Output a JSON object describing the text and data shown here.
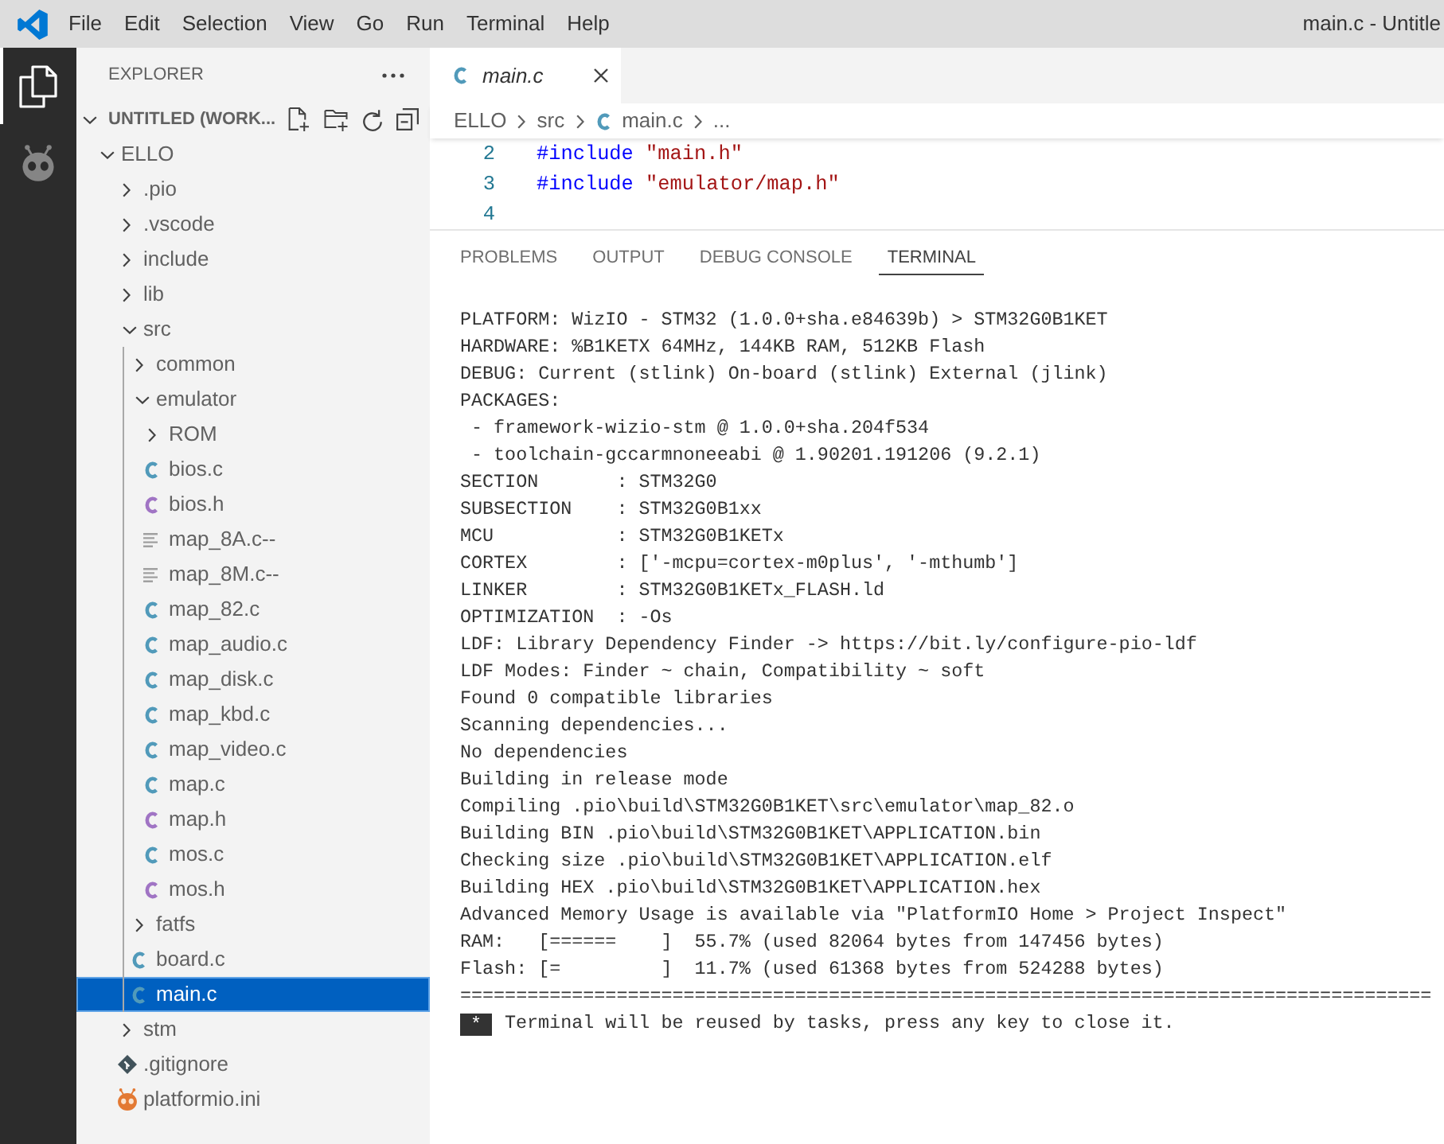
{
  "title_bar": {
    "menus": [
      "File",
      "Edit",
      "Selection",
      "View",
      "Go",
      "Run",
      "Terminal",
      "Help"
    ],
    "title": "main.c - Untitle"
  },
  "activity_bar": [
    {
      "kind": "explorer",
      "selected": true
    },
    {
      "kind": "platformio",
      "selected": false
    }
  ],
  "explorer": {
    "title": "EXPLORER",
    "workspace": {
      "label": "UNTITLED (WORK...",
      "expanded": true
    },
    "tree": [
      {
        "label": "ELLO",
        "kind": "folder",
        "expanded": true,
        "selected": false,
        "children": [
          {
            "label": ".pio",
            "kind": "folder",
            "expanded": false,
            "selected": false
          },
          {
            "label": ".vscode",
            "kind": "folder",
            "expanded": false,
            "selected": false
          },
          {
            "label": "include",
            "kind": "folder",
            "expanded": false,
            "selected": false
          },
          {
            "label": "lib",
            "kind": "folder",
            "expanded": false,
            "selected": false
          },
          {
            "label": "src",
            "kind": "folder",
            "expanded": true,
            "selected": false,
            "children": [
              {
                "label": "common",
                "kind": "folder",
                "expanded": false,
                "selected": false
              },
              {
                "label": "emulator",
                "kind": "folder",
                "expanded": true,
                "selected": false,
                "children": [
                  {
                    "label": "ROM",
                    "kind": "folder",
                    "expanded": false,
                    "selected": false
                  },
                  {
                    "label": "bios.c",
                    "kind": "c-source",
                    "selected": false
                  },
                  {
                    "label": "bios.h",
                    "kind": "c-header",
                    "selected": false
                  },
                  {
                    "label": "map_8A.c--",
                    "kind": "text",
                    "selected": false
                  },
                  {
                    "label": "map_8M.c--",
                    "kind": "text",
                    "selected": false
                  },
                  {
                    "label": "map_82.c",
                    "kind": "c-source",
                    "selected": false
                  },
                  {
                    "label": "map_audio.c",
                    "kind": "c-source",
                    "selected": false
                  },
                  {
                    "label": "map_disk.c",
                    "kind": "c-source",
                    "selected": false
                  },
                  {
                    "label": "map_kbd.c",
                    "kind": "c-source",
                    "selected": false
                  },
                  {
                    "label": "map_video.c",
                    "kind": "c-source",
                    "selected": false
                  },
                  {
                    "label": "map.c",
                    "kind": "c-source",
                    "selected": false
                  },
                  {
                    "label": "map.h",
                    "kind": "c-header",
                    "selected": false
                  },
                  {
                    "label": "mos.c",
                    "kind": "c-source",
                    "selected": false
                  },
                  {
                    "label": "mos.h",
                    "kind": "c-header",
                    "selected": false
                  }
                ]
              },
              {
                "label": "fatfs",
                "kind": "folder",
                "expanded": false,
                "selected": false
              },
              {
                "label": "board.c",
                "kind": "c-source",
                "selected": false
              },
              {
                "label": "main.c",
                "kind": "c-source",
                "selected": true
              }
            ]
          },
          {
            "label": "stm",
            "kind": "folder",
            "expanded": false,
            "selected": false
          },
          {
            "label": ".gitignore",
            "kind": "git",
            "selected": false
          },
          {
            "label": "platformio.ini",
            "kind": "platformio",
            "selected": false
          }
        ]
      }
    ]
  },
  "editor": {
    "tabs": [
      {
        "label": "main.c",
        "kind": "c-source",
        "selected": true,
        "preview": true
      }
    ],
    "breadcrumbs": [
      {
        "label": "ELLO",
        "kind": "folder"
      },
      {
        "label": "src",
        "kind": "folder"
      },
      {
        "label": "main.c",
        "kind": "c-source"
      },
      {
        "label": "...",
        "kind": "more"
      }
    ],
    "code_lines": [
      {
        "number": "2",
        "directive": "#include",
        "argument": "\"main.h\""
      },
      {
        "number": "3",
        "directive": "#include",
        "argument": "\"emulator/map.h\""
      },
      {
        "number": "4"
      }
    ]
  },
  "panel": {
    "tabs": [
      {
        "label": "PROBLEMS",
        "selected": false
      },
      {
        "label": "OUTPUT",
        "selected": false
      },
      {
        "label": "DEBUG CONSOLE",
        "selected": false
      },
      {
        "label": "TERMINAL",
        "selected": true
      }
    ],
    "terminal": {
      "lines": [
        "PLATFORM: WizIO - STM32 (1.0.0+sha.e84639b) > STM32G0B1KET",
        "HARDWARE: %B1KETX 64MHz, 144KB RAM, 512KB Flash",
        "DEBUG: Current (stlink) On-board (stlink) External (jlink)",
        "PACKAGES:",
        " - framework-wizio-stm @ 1.0.0+sha.204f534",
        " - toolchain-gccarmnoneeabi @ 1.90201.191206 (9.2.1)",
        "SECTION       : STM32G0",
        "SUBSECTION    : STM32G0B1xx",
        "MCU           : STM32G0B1KETx",
        "CORTEX        : ['-mcpu=cortex-m0plus', '-mthumb']",
        "LINKER        : STM32G0B1KETx_FLASH.ld",
        "OPTIMIZATION  : -Os",
        "LDF: Library Dependency Finder -> https://bit.ly/configure-pio-ldf",
        "LDF Modes: Finder ~ chain, Compatibility ~ soft",
        "Found 0 compatible libraries",
        "Scanning dependencies...",
        "No dependencies",
        "Building in release mode",
        "Compiling .pio\\build\\STM32G0B1KET\\src\\emulator\\map_82.o",
        "Building BIN .pio\\build\\STM32G0B1KET\\APPLICATION.bin",
        "Checking size .pio\\build\\STM32G0B1KET\\APPLICATION.elf",
        "Building HEX .pio\\build\\STM32G0B1KET\\APPLICATION.hex",
        "Advanced Memory Usage is available via \"PlatformIO Home > Project Inspect\"",
        "RAM:   [======    ]  55.7% (used 82064 bytes from 147456 bytes)",
        "Flash: [=         ]  11.7% (used 61368 bytes from 524288 bytes)",
        "======================================================================================="
      ],
      "notice": {
        "badge": "*",
        "text": "Terminal will be reused by tasks, press any key to close it."
      }
    }
  }
}
